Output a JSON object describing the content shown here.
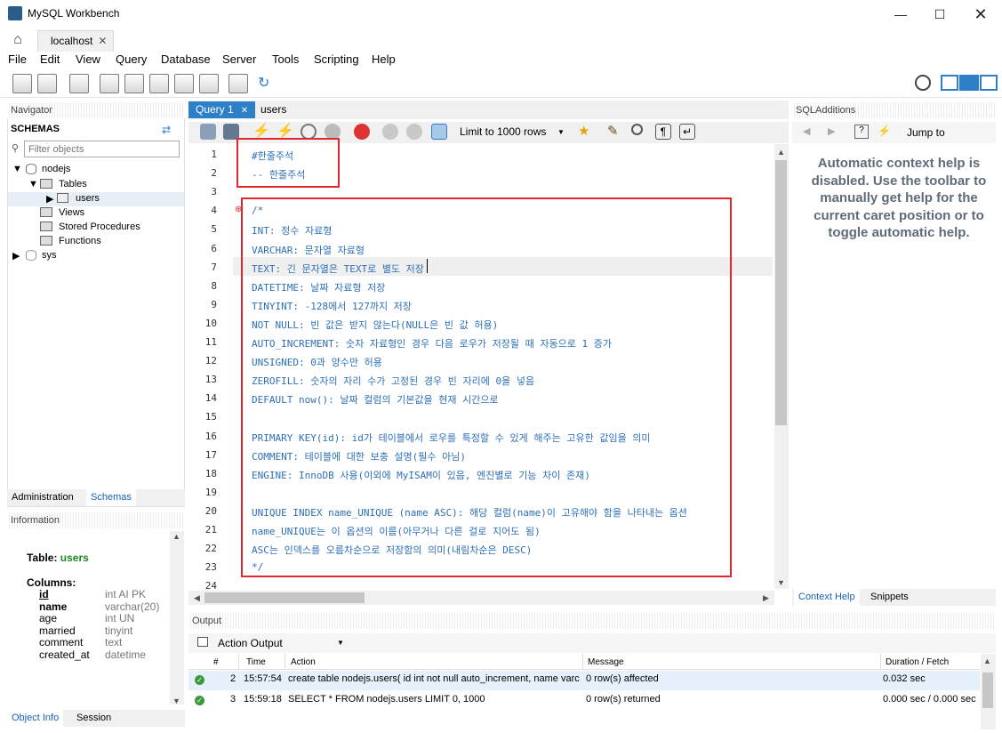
{
  "window": {
    "title": "MySQL Workbench"
  },
  "tabs": {
    "connection": "localhost"
  },
  "menu": [
    "File",
    "Edit",
    "View",
    "Query",
    "Database",
    "Server",
    "Tools",
    "Scripting",
    "Help"
  ],
  "navigator": {
    "header": "Navigator",
    "schemas_label": "SCHEMAS",
    "filter_placeholder": "Filter objects",
    "tree": {
      "nodejs": "nodejs",
      "tables": "Tables",
      "users": "users",
      "views": "Views",
      "procedures": "Stored Procedures",
      "functions": "Functions",
      "sys": "sys"
    },
    "tabs": {
      "administration": "Administration",
      "schemas": "Schemas"
    }
  },
  "information": {
    "header": "Information",
    "table_label": "Table:",
    "table_name": "users",
    "columns_label": "Columns:",
    "columns": [
      {
        "name": "id",
        "type": "int AI PK"
      },
      {
        "name": "name",
        "type": "varchar(20)"
      },
      {
        "name": "age",
        "type": "int UN"
      },
      {
        "name": "married",
        "type": "tinyint"
      },
      {
        "name": "comment",
        "type": "text"
      },
      {
        "name": "created_at",
        "type": "datetime"
      }
    ],
    "tabs": {
      "object_info": "Object Info",
      "session": "Session"
    }
  },
  "editor": {
    "tabs": {
      "query1": "Query 1",
      "users": "users"
    },
    "limit": "Limit to 1000 rows",
    "lines": [
      "#한줄주석",
      "-- 한줄주석",
      "",
      "/*",
      "INT: 정수 자료형",
      "VARCHAR: 문자열 자료형",
      "TEXT: 긴 문자열은 TEXT로 별도 저장",
      "DATETIME: 날짜 자료형 저장",
      "TINYINT: -128에서 127까지 저장",
      "NOT NULL: 빈 값은 받지 않는다(NULL은 빈 값 허용)",
      "AUTO_INCREMENT: 숫자 자료형인 경우 다음 로우가 저장될 때 자동으로 1 증가",
      "UNSIGNED: 0과 양수만 허용",
      "ZEROFILL: 숫자의 자리 수가 고정된 경우 빈 자리에 0을 넣음",
      "DEFAULT now(): 날짜 컬럼의 기본값을 현재 시간으로",
      "",
      "PRIMARY KEY(id): id가 테이블에서 로우를 특정할 수 있게 해주는 고유한 값임을 의미",
      "COMMENT: 테이블에 대한 보충 설명(필수 아님)",
      "ENGINE: InnoDB 사용(이외에 MyISAM이 있음, 엔진별로 기능 차이 존재)",
      "",
      "UNIQUE INDEX name_UNIQUE (name ASC): 해당 컬럼(name)이 고유해야 함을 나타내는 옵션",
      "name_UNIQUE는 이 옵션의 이름(아무거나 다른 걸로 지어도 됨)",
      "ASC는 인덱스를 오름차순으로 저장함의 의미(내림차순은 DESC)",
      "*/",
      ""
    ]
  },
  "sql_additions": {
    "header": "SQLAdditions",
    "jump_to": "Jump to",
    "help_text": "Automatic context help is disabled. Use the toolbar to manually get help for the current caret position or to toggle automatic help.",
    "tabs": {
      "context_help": "Context Help",
      "snippets": "Snippets"
    }
  },
  "output": {
    "header": "Output",
    "selector": "Action Output",
    "columns": {
      "hash": "#",
      "time": "Time",
      "action": "Action",
      "message": "Message",
      "duration": "Duration / Fetch"
    },
    "rows": [
      {
        "n": "2",
        "time": "15:57:54",
        "action": "create table nodejs.users( id int not null auto_increment, name varc...",
        "message": "0 row(s) affected",
        "duration": "0.032 sec"
      },
      {
        "n": "3",
        "time": "15:59:18",
        "action": "SELECT * FROM nodejs.users LIMIT 0, 1000",
        "message": "0 row(s) returned",
        "duration": "0.000 sec / 0.000 sec"
      }
    ]
  },
  "colors": {
    "accent": "#2d7fc8",
    "code": "#2d6fb7",
    "annotation": "#e3262b",
    "table_name": "#1d8a1d"
  }
}
